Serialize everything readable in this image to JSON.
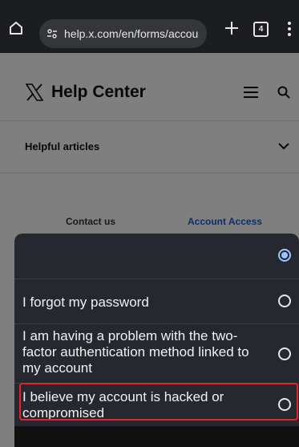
{
  "browser": {
    "url": "help.x.com/en/forms/accou",
    "tab_count": "4"
  },
  "help_center": {
    "title": "Help Center",
    "helpful_label": "Helpful articles",
    "breadcrumb_contact": "Contact us",
    "breadcrumb_access": "Account Access"
  },
  "select_options": [
    {
      "label": "",
      "selected": true
    },
    {
      "label": "I forgot my password",
      "selected": false
    },
    {
      "label": "I am having a problem with the two-factor authentication method linked to my account",
      "selected": false
    },
    {
      "label": "I believe my account is hacked or compromised",
      "selected": false
    }
  ],
  "colors": {
    "browser_bar": "#1c1d20",
    "sheet_bg": "#26282f",
    "radio_selected": "#9cc5ff",
    "highlight": "#e5232c",
    "link": "#1d5bd6"
  },
  "icons": [
    "home-icon",
    "site-settings-icon",
    "plus-icon",
    "tab-count-icon",
    "more-vert-icon",
    "x-logo-icon",
    "menu-icon",
    "search-icon",
    "chevron-down-icon",
    "radio-icon"
  ]
}
